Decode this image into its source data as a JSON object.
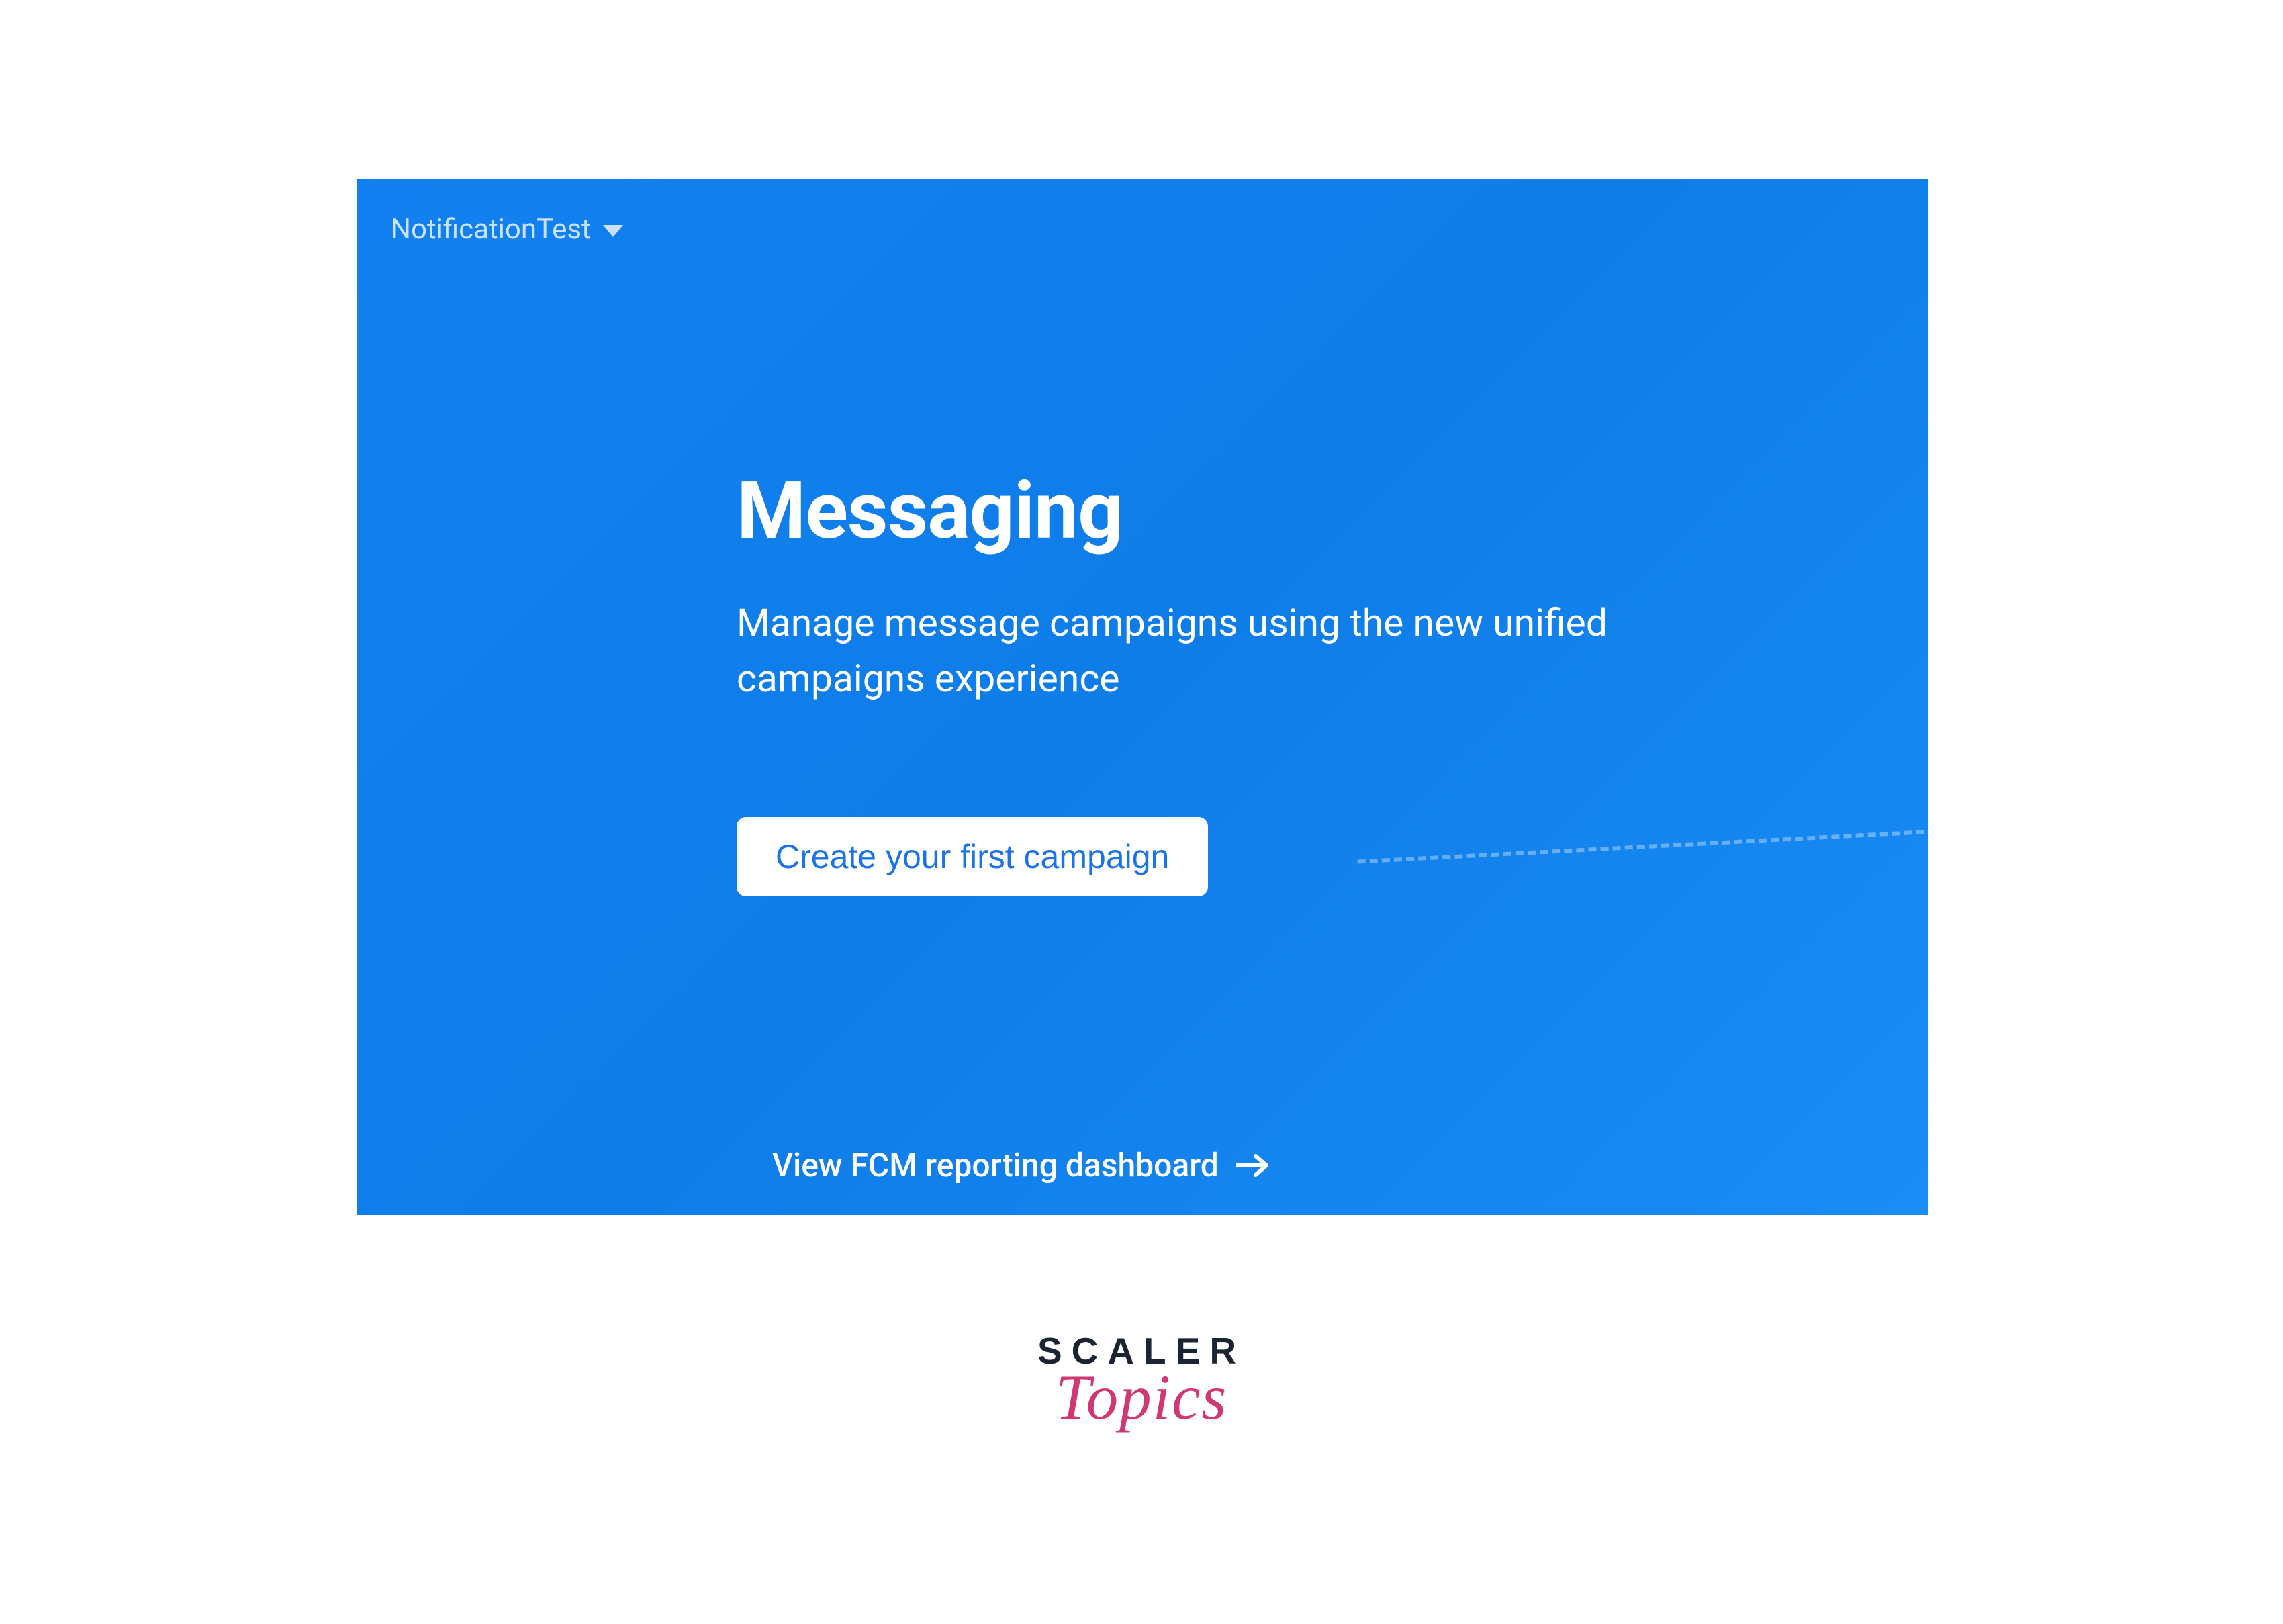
{
  "project": {
    "name": "NotificationTest"
  },
  "hero": {
    "title": "Messaging",
    "subtitle": "Manage message campaigns using the new unified campaigns experience"
  },
  "actions": {
    "primary_button": "Create your first campaign",
    "secondary_link": "View FCM reporting dashboard"
  },
  "branding": {
    "scaler": "SCALER",
    "topics": "Topics"
  }
}
